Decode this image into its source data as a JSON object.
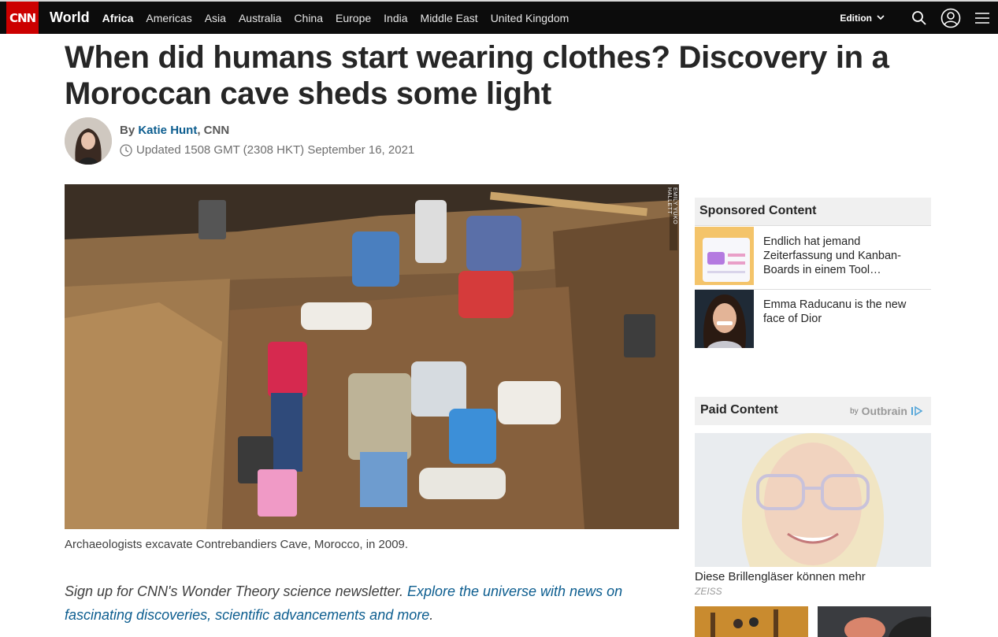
{
  "nav": {
    "logo": "CNN",
    "section": "World",
    "links": [
      "Africa",
      "Americas",
      "Asia",
      "Australia",
      "China",
      "Europe",
      "India",
      "Middle East",
      "United Kingdom"
    ],
    "edition": "Edition",
    "icons": [
      "search-icon",
      "account-icon",
      "menu-icon"
    ]
  },
  "article": {
    "headline": "When did humans start wearing clothes? Discovery in a Moroccan cave sheds some light",
    "byline_prefix": "By ",
    "author": "Katie Hunt",
    "byline_suffix": ", CNN",
    "timestamp": "Updated 1508 GMT (2308 HKT) September 16, 2021",
    "image_credit": "EMILY YUKO HALLETT",
    "caption": "Archaeologists excavate Contrebandiers Cave, Morocco, in 2009.",
    "promo_text": "Sign up for CNN's Wonder Theory science newsletter. ",
    "promo_link": "Explore the universe with news on fascinating discoveries, scientific advancements and more",
    "promo_end": "."
  },
  "sidebar": {
    "sponsored_title": "Sponsored Content",
    "sponsored_items": [
      {
        "text": "Endlich hat jemand Zeiterfassung und Kanban-Boards in einem Tool…"
      },
      {
        "text": "Emma Raducanu is the new face of Dior"
      }
    ],
    "paid_title": "Paid Content",
    "paid_by": "by",
    "paid_provider": "Outbrain",
    "paid_item_title": "Diese Brillengläser können mehr",
    "paid_item_source": "ZEISS"
  },
  "colors": {
    "brand_red": "#cc0000",
    "nav_bg": "#0c0c0c",
    "link_blue": "#0c5d8f"
  }
}
